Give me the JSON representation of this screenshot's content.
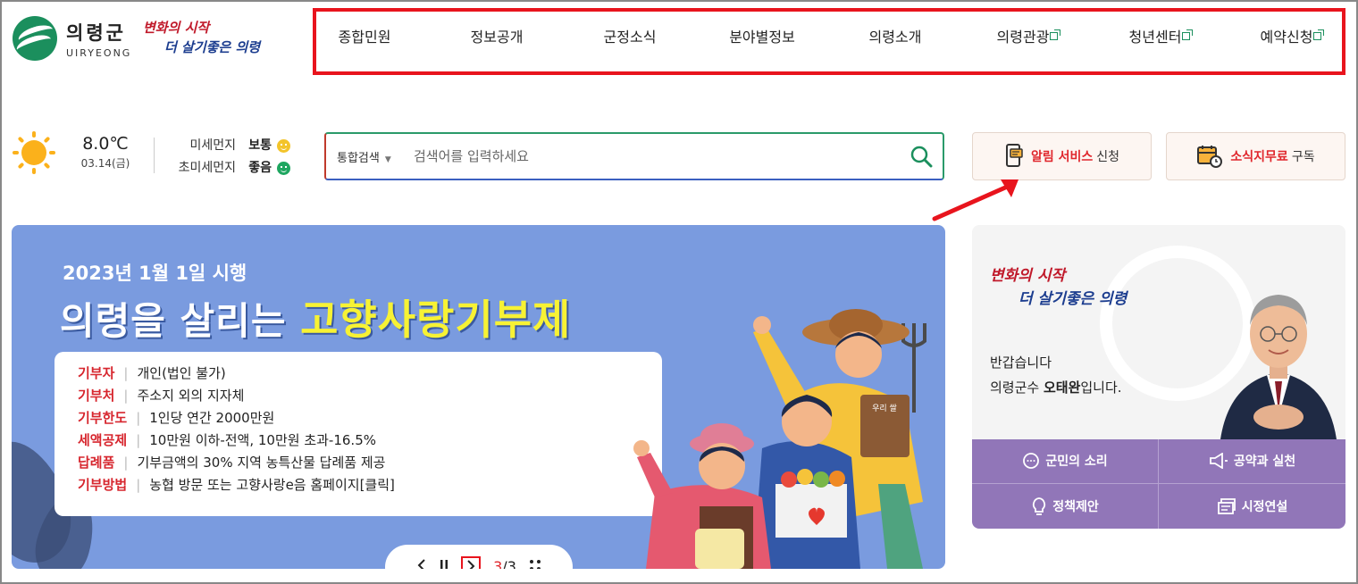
{
  "header": {
    "logo_ko": "의령군",
    "logo_en": "UIRYEONG",
    "slogan_line1": "변화의 시작",
    "slogan_line2": "더 살기좋은 의령"
  },
  "gnb": {
    "items": [
      {
        "label": "종합민원",
        "external": false
      },
      {
        "label": "정보공개",
        "external": false
      },
      {
        "label": "군정소식",
        "external": false
      },
      {
        "label": "분야별정보",
        "external": false
      },
      {
        "label": "의령소개",
        "external": false
      },
      {
        "label": "의령관광",
        "external": true
      },
      {
        "label": "청년센터",
        "external": true
      },
      {
        "label": "예약신청",
        "external": true
      }
    ]
  },
  "weather": {
    "temp": "8.0℃",
    "date": "03.14(금)",
    "dust_label": "미세먼지",
    "dust_value": "보통",
    "ultra_label": "초미세먼지",
    "ultra_value": "좋음"
  },
  "search": {
    "scope": "통합검색",
    "placeholder": "검색어를 입력하세요"
  },
  "quick": {
    "alert_red": "알림 서비스",
    "alert_black": "신청",
    "news_red": "소식지무료",
    "news_black": "구독"
  },
  "banner": {
    "subtitle": "2023년 1월 1일 시행",
    "title_white": "의령을 살리는",
    "title_yellow": "고향사랑기부제",
    "rows": [
      {
        "k": "기부자",
        "v": "개인(법인 불가)"
      },
      {
        "k": "기부처",
        "v": "주소지 외의 지자체"
      },
      {
        "k": "기부한도",
        "v": "1인당 연간 2000만원"
      },
      {
        "k": "세액공제",
        "v": "10만원 이하-전액, 10만원 초과-16.5%"
      },
      {
        "k": "답례품",
        "v": "기부금액의 30% 지역 농특산물 답례품 제공"
      },
      {
        "k": "기부방법",
        "v": "농협 방문 또는 고향사랑e음 홈페이지[클릭]"
      }
    ],
    "bag_text": "우리 쌀",
    "page_current": "3",
    "page_total": "/3"
  },
  "mayor": {
    "slogan_line1": "변화의 시작",
    "slogan_line2": "더 살기좋은 의령",
    "greet1": "반갑습니다",
    "greet2_a": "의령군수 ",
    "greet2_name": "오태완",
    "greet2_b": "입니다."
  },
  "mayor_menu": {
    "voice": "군민의 소리",
    "pledge": "공약과 실천",
    "policy": "정책제안",
    "speech": "시정연설"
  },
  "colors": {
    "brand_green": "#1b8f5d",
    "highlight_red": "#e8141d",
    "banner_blue": "#7a9bdf",
    "mayor_purple": "#9176b8"
  }
}
